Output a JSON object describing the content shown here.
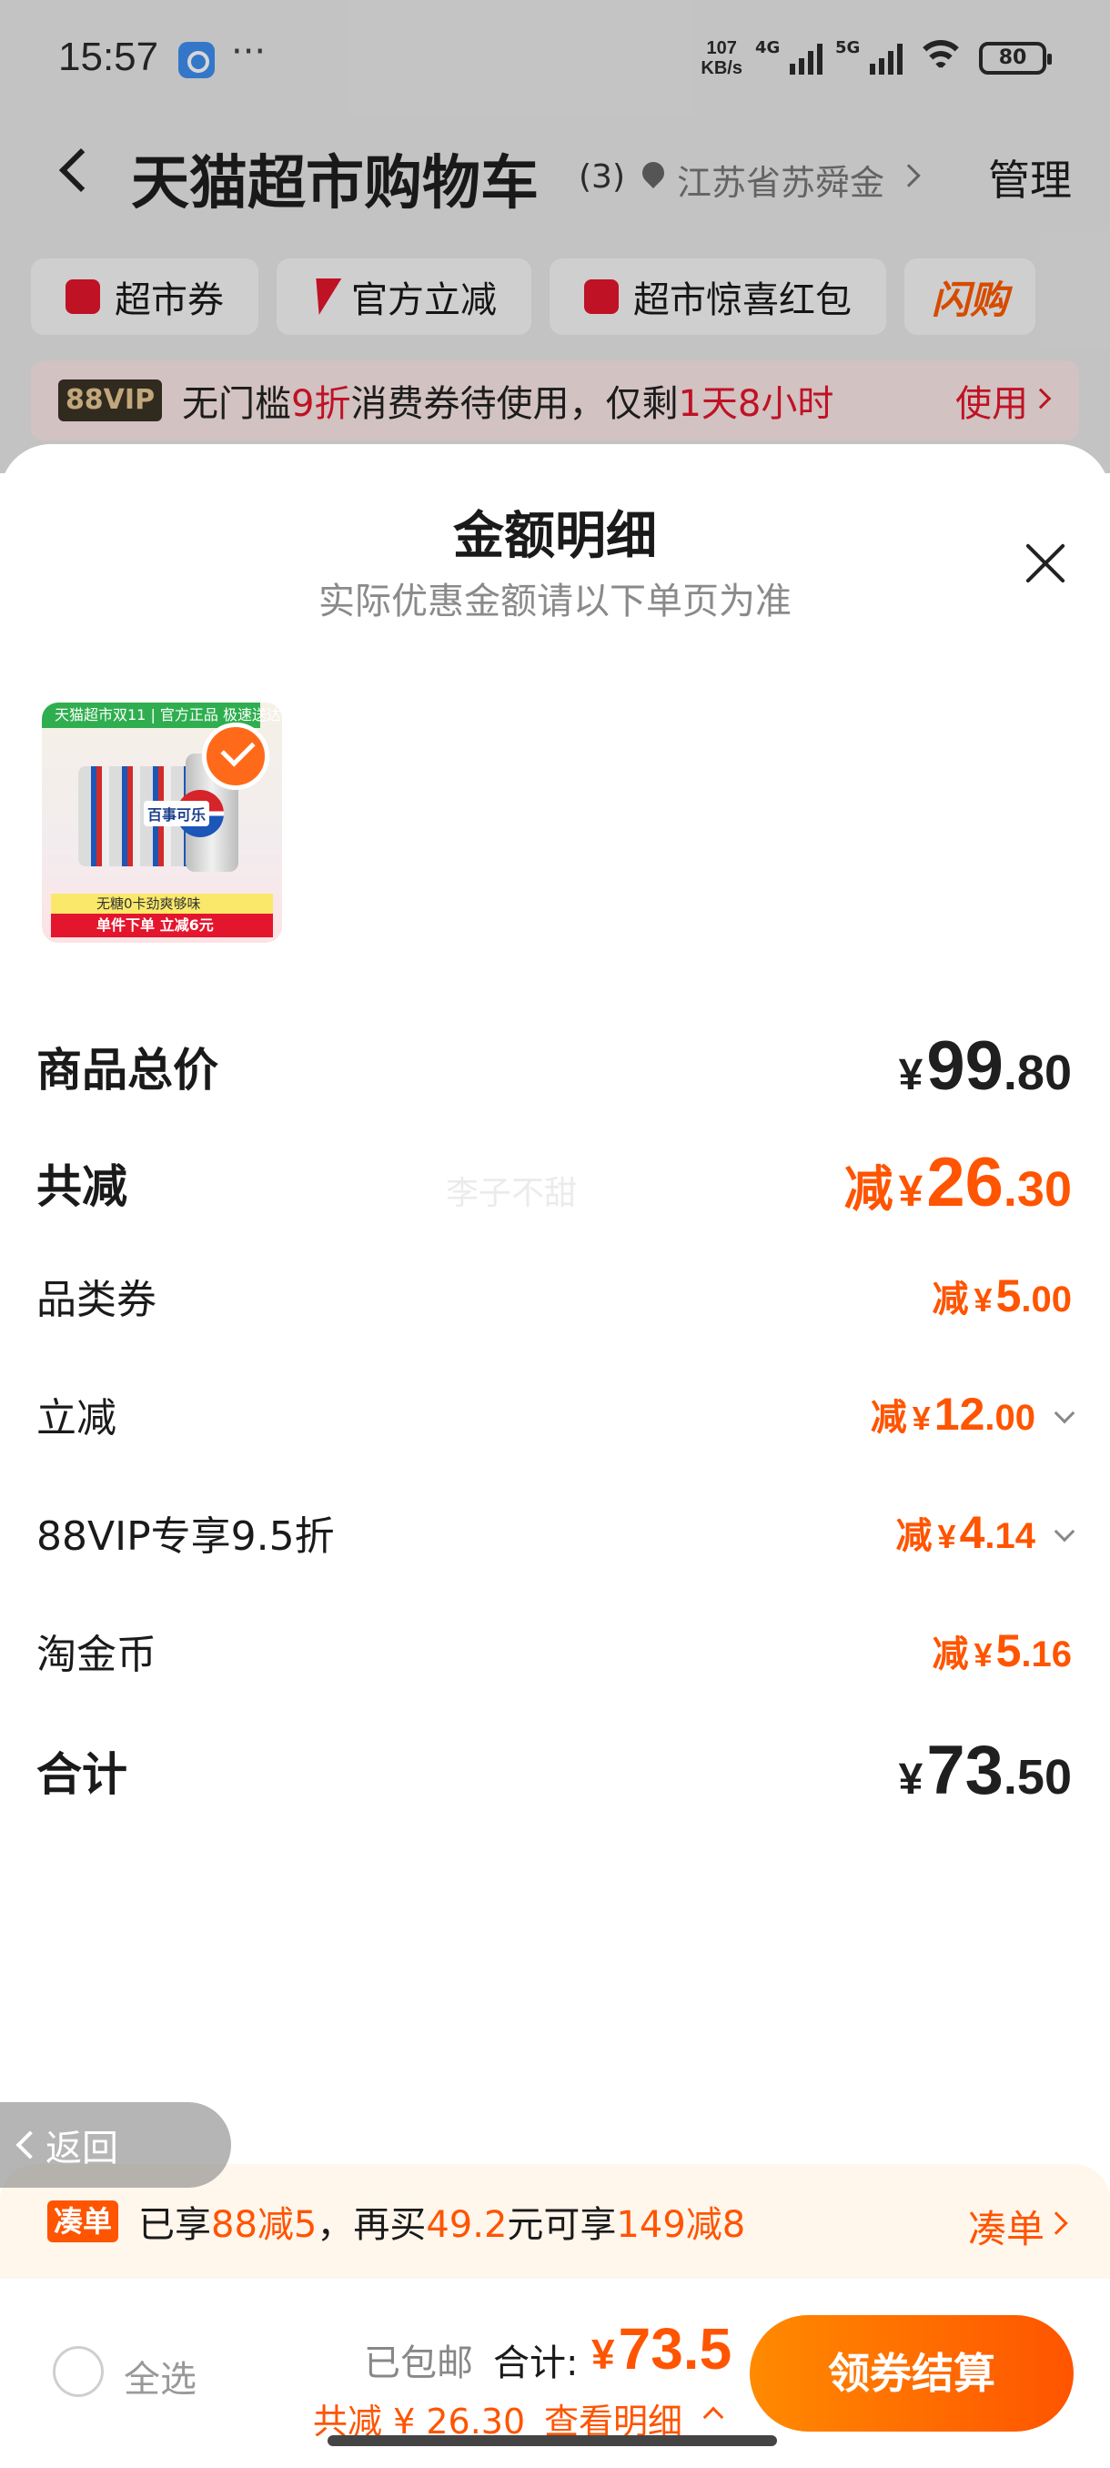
{
  "status_bar": {
    "time": "15:57",
    "dots": "···",
    "speed_value": "107",
    "speed_unit": "KB/s",
    "net1": "4G",
    "net2": "5G",
    "battery": "80"
  },
  "header": {
    "title": "天猫超市购物车",
    "count": "(3)",
    "address": "江苏省苏舜金",
    "manage": "管理"
  },
  "chips": [
    {
      "label": "超市券",
      "icon": "coupon-icon"
    },
    {
      "label": "官方立减",
      "icon": "bolt-icon"
    },
    {
      "label": "超市惊喜红包",
      "icon": "red-packet-icon"
    },
    {
      "label": "闪购",
      "icon": "flash-buy-logo"
    }
  ],
  "vip_banner": {
    "badge": "88VIP",
    "text_before": "无门槛",
    "text_highlight": "9折",
    "text_middle": "消费券待使用，仅剩",
    "text_time": "1天8小时",
    "action": "使用"
  },
  "sheet": {
    "title": "金额明细",
    "subtitle": "实际优惠金额请以下单页为准",
    "product_image": {
      "top_banner": "天猫超市双11 | 官方正品 极速送达",
      "brand": "百事可乐",
      "tag1": "无糖0卡劲爽够味",
      "tag2": "单件下单 立减6元"
    },
    "rows": [
      {
        "label": "商品总价",
        "prefix": "",
        "yen": "¥",
        "int": "99",
        "dec": ".80",
        "expandable": false
      },
      {
        "label": "共减",
        "prefix": "减",
        "yen": "¥",
        "int": "26",
        "dec": ".30",
        "expandable": false
      },
      {
        "label": "品类券",
        "prefix": "减",
        "yen": "¥",
        "int": "5",
        "dec": ".00",
        "expandable": false
      },
      {
        "label": "立减",
        "prefix": "减",
        "yen": "¥",
        "int": "12",
        "dec": ".00",
        "expandable": true
      },
      {
        "label": "88VIP专享9.5折",
        "prefix": "减",
        "yen": "¥",
        "int": "4",
        "dec": ".14",
        "expandable": true
      },
      {
        "label": "淘金币",
        "prefix": "减",
        "yen": "¥",
        "int": "5",
        "dec": ".16",
        "expandable": false
      },
      {
        "label": "合计",
        "prefix": "",
        "yen": "¥",
        "int": "73",
        "dec": ".50",
        "expandable": false
      }
    ],
    "watermark": "李子不甜"
  },
  "back_pill": {
    "label": "返回"
  },
  "promo": {
    "badge": "凑单",
    "text_a": "已享",
    "text_b": "88减5",
    "text_c": "，再买",
    "text_d": "49.2",
    "text_e": "元可享",
    "text_f": "149减8",
    "link": "凑单"
  },
  "checkout": {
    "select_all": "全选",
    "shipping": "已包邮",
    "total_label": "合计:",
    "total_yen": "¥",
    "total_value": "73.5",
    "saved": "共减 ¥ 26.30",
    "detail": "查看明细",
    "button": "领券结算"
  },
  "colors": {
    "accent_orange": "#ff5400",
    "tmall_red": "#e4162d"
  }
}
